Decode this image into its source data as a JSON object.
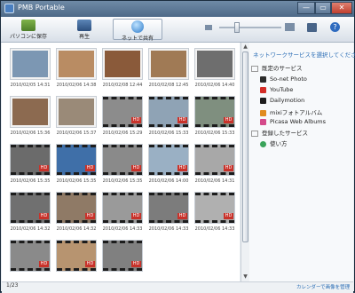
{
  "window": {
    "title": "PMB Portable",
    "min": "—",
    "max": "▭",
    "close": "✕"
  },
  "toolbar": {
    "save_label": "パソコンに保存",
    "play_label": "再生",
    "share_label": "ネットで共有"
  },
  "thumbnails": [
    {
      "date": "2010/02/05 14:31",
      "video": false,
      "color": "#7c97b3"
    },
    {
      "date": "2010/02/06 14:38",
      "video": false,
      "color": "#b98c63"
    },
    {
      "date": "2010/02/08 12:44",
      "video": false,
      "color": "#8a5a3a"
    },
    {
      "date": "2010/02/08 12:45",
      "video": false,
      "color": "#a07a55"
    },
    {
      "date": "2010/02/06 14:40",
      "video": false,
      "color": "#6e6e6e"
    },
    {
      "date": "2010/02/06 15:36",
      "video": false,
      "color": "#8c6a50"
    },
    {
      "date": "2010/02/06 15:37",
      "video": false,
      "color": "#9a8a78"
    },
    {
      "date": "2010/02/06 15:29",
      "video": true,
      "color": "#8c8c8c"
    },
    {
      "date": "2010/02/06 15:33",
      "video": true,
      "color": "#8fa3b5"
    },
    {
      "date": "2010/02/06 15:33",
      "video": true,
      "color": "#7f8f7f"
    },
    {
      "date": "2010/02/06 15:35",
      "video": true,
      "color": "#6b6b6b"
    },
    {
      "date": "2010/02/06 15:35",
      "video": true,
      "color": "#3f6fa8"
    },
    {
      "date": "2010/02/06 15:35",
      "video": true,
      "color": "#8a8a8a"
    },
    {
      "date": "2010/02/06 14:00",
      "video": true,
      "color": "#9ab0c4"
    },
    {
      "date": "2010/02/06 14:31",
      "video": true,
      "color": "#a8a8a8"
    },
    {
      "date": "2010/02/06 14:32",
      "video": true,
      "color": "#707070"
    },
    {
      "date": "2010/02/06 14:32",
      "video": true,
      "color": "#8f7a66"
    },
    {
      "date": "2010/02/06 14:33",
      "video": true,
      "color": "#9a9a9a"
    },
    {
      "date": "2010/02/06 14:33",
      "video": true,
      "color": "#7c7c7c"
    },
    {
      "date": "2010/02/06 14:33",
      "video": true,
      "color": "#b0b0b0"
    },
    {
      "date": "",
      "video": true,
      "color": "#8a8a8a"
    },
    {
      "date": "",
      "video": true,
      "color": "#b79470"
    },
    {
      "date": "",
      "video": true,
      "color": "#808080"
    }
  ],
  "count_label": "1/23",
  "panel": {
    "header": "ネットワークサービスを選択してください",
    "section1": "既定のサービス",
    "services": [
      {
        "label": "So-net Photo",
        "color": "#2b2b2b"
      },
      {
        "label": "YouTube",
        "color": "#d32d27"
      },
      {
        "label": "Dailymotion",
        "color": "#1d1d1d"
      },
      {
        "label": "mixiフォトアルバム",
        "color": "#e08b1f"
      },
      {
        "label": "Picasa Web Albums",
        "color": "#d44a8a"
      }
    ],
    "section2": "登録したサービス",
    "howto": "使い方",
    "howto_color": "#3aa35a"
  },
  "status": {
    "calendar_link": "カレンダーで画像を管理"
  }
}
